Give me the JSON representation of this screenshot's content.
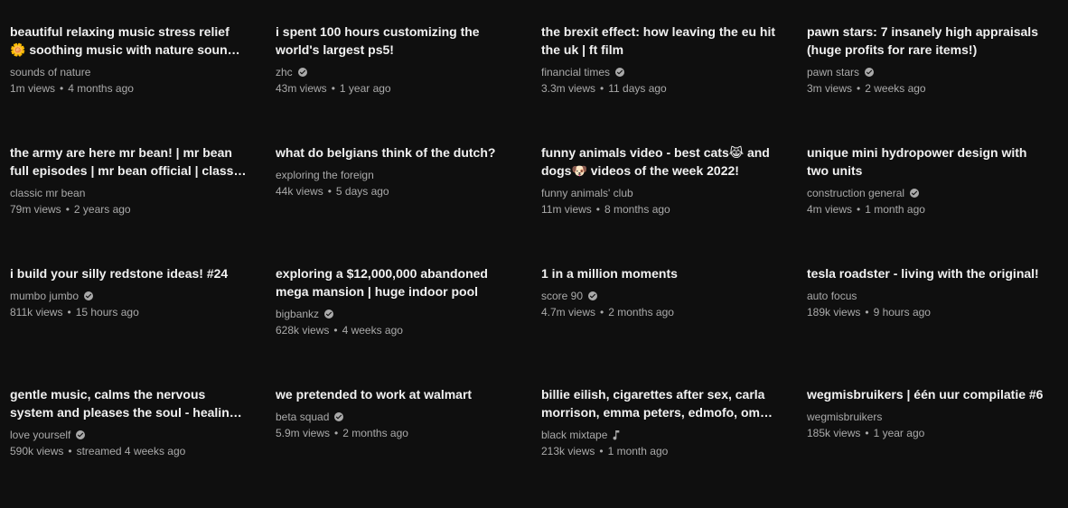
{
  "colors": {
    "background": "#0f0f0f",
    "title": "#f1f1f1",
    "secondary": "#aaaaaa"
  },
  "videos": [
    {
      "title": "beautiful relaxing music stress relief 🌼 soothing music with nature sound & relaxing",
      "channel": "sounds of nature",
      "badge": "",
      "views": "1m views",
      "age": "4 months ago"
    },
    {
      "title": "i spent 100 hours customizing the world's largest ps5!",
      "channel": "zhc",
      "badge": "verified-icon",
      "views": "43m views",
      "age": "1 year ago"
    },
    {
      "title": "the brexit effect: how leaving the eu hit the uk | ft film",
      "channel": "financial times",
      "badge": "verified-icon",
      "views": "3.3m views",
      "age": "11 days ago"
    },
    {
      "title": "pawn stars: 7 insanely high appraisals (huge profits for rare items!)",
      "channel": "pawn stars",
      "badge": "verified-icon",
      "views": "3m views",
      "age": "2 weeks ago"
    },
    {
      "title": "the army are here mr bean! | mr bean full episodes | mr bean official | classic mr bean",
      "channel": "classic mr bean",
      "badge": "",
      "views": "79m views",
      "age": "2 years ago"
    },
    {
      "title": "what do belgians think of the dutch?",
      "channel": "exploring the foreign",
      "badge": "",
      "views": "44k views",
      "age": "5 days ago"
    },
    {
      "title": "funny animals video - best cats😹 and dogs🐶 videos of the week 2022!",
      "channel": "funny animals' club",
      "badge": "",
      "views": "11m views",
      "age": "8 months ago"
    },
    {
      "title": "unique mini hydropower design with two units",
      "channel": "construction general",
      "badge": "verified-icon",
      "views": "4m views",
      "age": "1 month ago"
    },
    {
      "title": "i build your silly redstone ideas! #24",
      "channel": "mumbo jumbo",
      "badge": "verified-icon",
      "views": "811k views",
      "age": "15 hours ago"
    },
    {
      "title": "exploring a $12,000,000 abandoned mega mansion | huge indoor pool",
      "channel": "bigbankz",
      "badge": "verified-icon",
      "views": "628k views",
      "age": "4 weeks ago"
    },
    {
      "title": "1 in a million moments",
      "channel": "score 90",
      "badge": "verified-icon",
      "views": "4.7m views",
      "age": "2 months ago"
    },
    {
      "title": "tesla roadster - living with the original!",
      "channel": "auto focus",
      "badge": "",
      "views": "189k views",
      "age": "9 hours ago"
    },
    {
      "title": "gentle music, calms the nervous system and pleases the soul - healing music for the heart",
      "channel": "love yourself",
      "badge": "verified-icon",
      "views": "590k views",
      "age": "streamed 4 weeks ago"
    },
    {
      "title": "we pretended to work at walmart",
      "channel": "beta squad",
      "badge": "verified-icon",
      "views": "5.9m views",
      "age": "2 months ago"
    },
    {
      "title": "billie eilish, cigarettes after sex, carla morrison, emma peters, edmofo, omer adam",
      "channel": "black mixtape",
      "badge": "music-note-icon",
      "views": "213k views",
      "age": "1 month ago"
    },
    {
      "title": "wegmisbruikers | één uur compilatie #6",
      "channel": "wegmisbruikers",
      "badge": "",
      "views": "185k views",
      "age": "1 year ago"
    }
  ]
}
